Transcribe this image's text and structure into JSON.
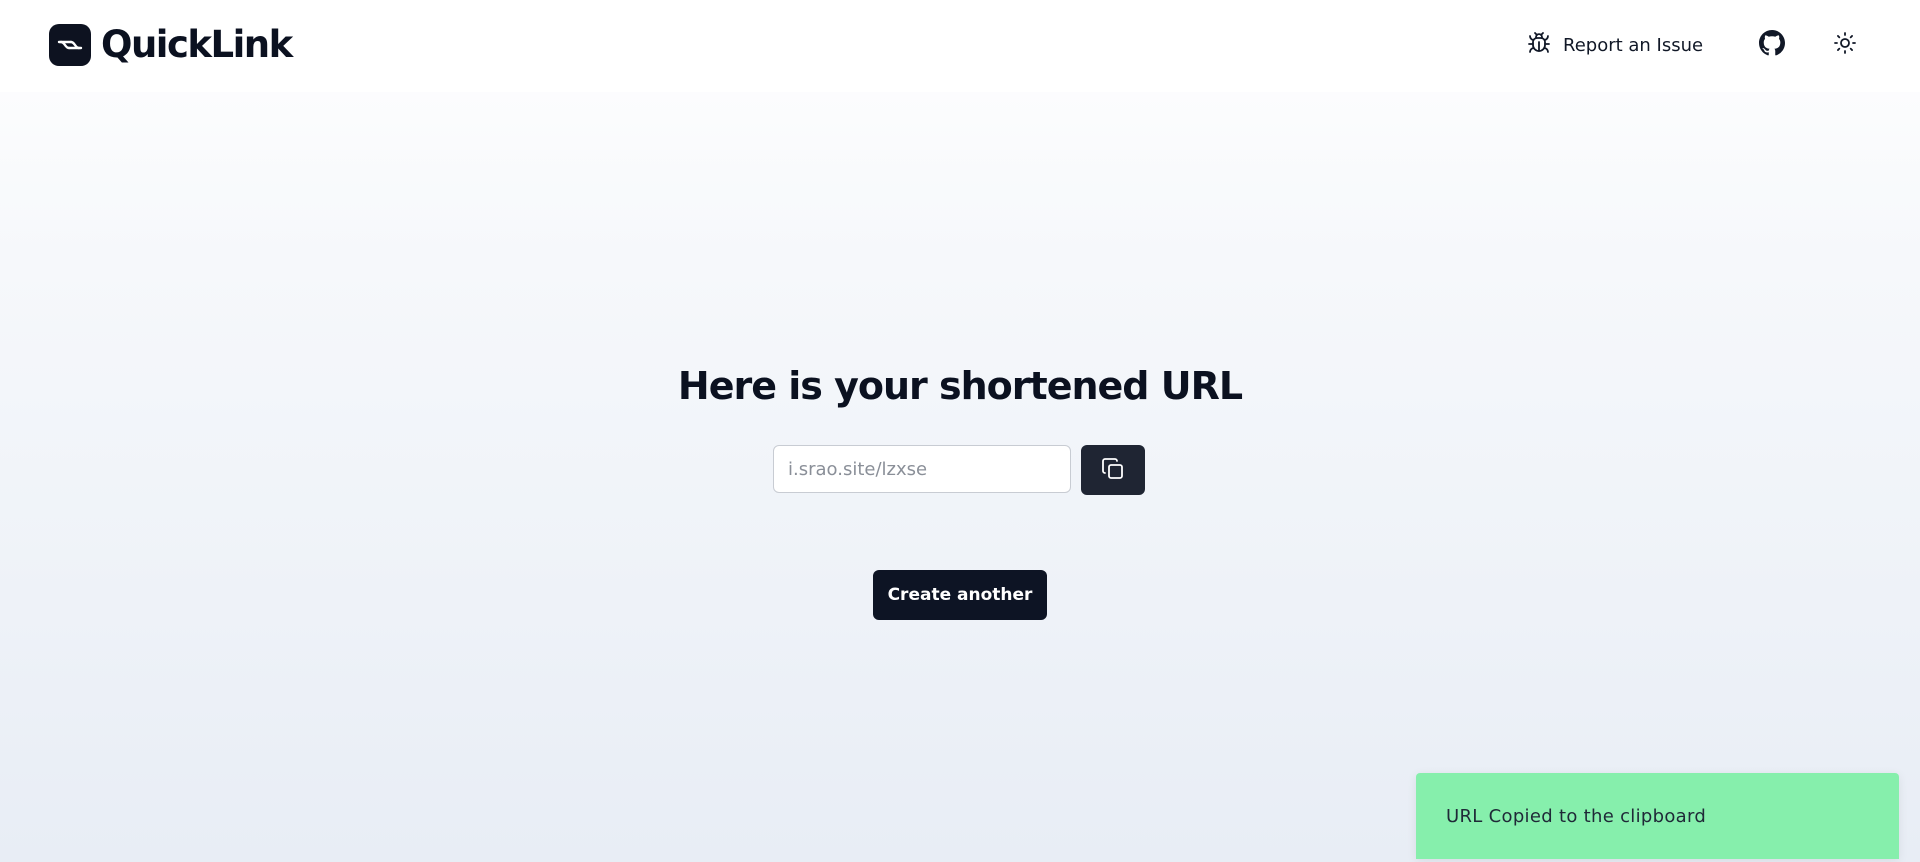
{
  "header": {
    "brand": "QuickLink",
    "report_label": "Report an Issue"
  },
  "main": {
    "title": "Here is your shortened URL",
    "short_url": "i.srao.site/lzxse",
    "create_label": "Create another"
  },
  "toast": {
    "message": "URL Copied to the clipboard"
  },
  "icons": {
    "logo": "link-logo-icon",
    "report": "bug-icon",
    "github": "github-icon",
    "theme": "sun-icon",
    "copy": "copy-icon"
  },
  "colors": {
    "primary": "#0d1424",
    "copy_button": "#1f2533",
    "toast_bg": "#86efac"
  }
}
